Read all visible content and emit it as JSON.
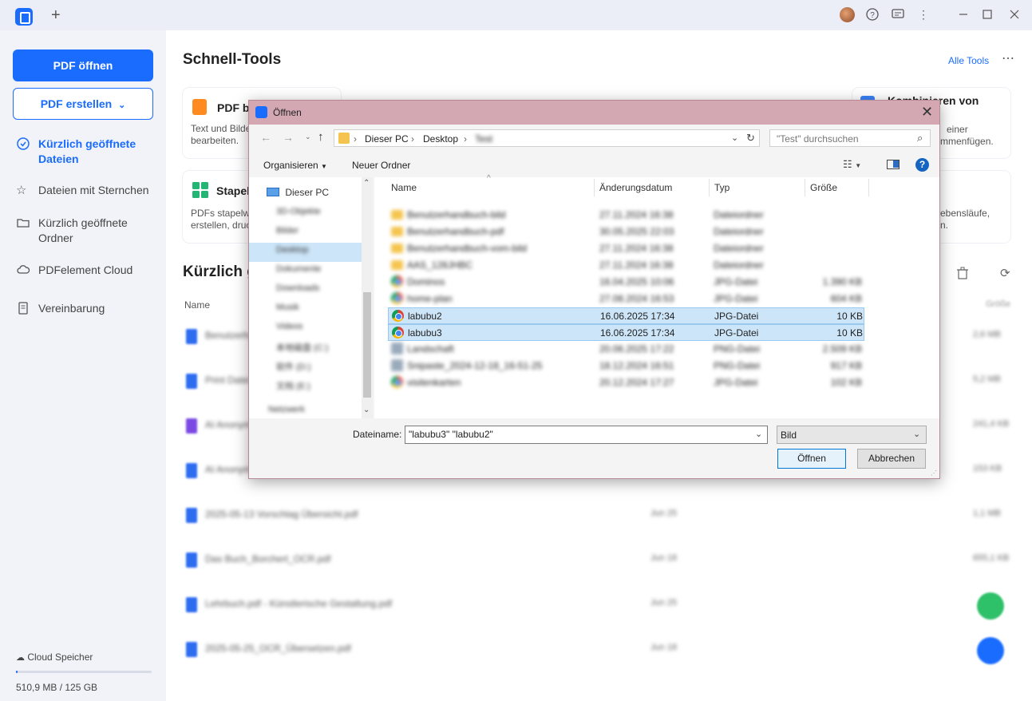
{
  "titlebar": {
    "new_tab": "+",
    "icons": [
      "avatar",
      "help-icon",
      "feedback-icon",
      "more-vertical-icon",
      "minimize-icon",
      "maximize-icon",
      "close-icon"
    ]
  },
  "sidebar": {
    "open_pdf": "PDF öffnen",
    "create_pdf": "PDF erstellen",
    "create_chevron": "⌄",
    "items": [
      {
        "label": "Kürzlich geöffnete Dateien",
        "icon": "clock-icon",
        "active": true
      },
      {
        "label": "Dateien mit Sternchen",
        "icon": "star-icon",
        "active": false
      },
      {
        "label": "Kürzlich geöffnete Ordner",
        "icon": "folder-icon",
        "active": false
      },
      {
        "label": "PDFelement Cloud",
        "icon": "cloud-icon",
        "active": false
      },
      {
        "label": "Vereinbarung",
        "icon": "document-icon",
        "active": false
      }
    ],
    "cloud_label": "Cloud Speicher",
    "storage_text": "510,9 MB / 125 GB",
    "storage_used_fraction": 0.004
  },
  "main": {
    "title": "Schnell-Tools",
    "all_tools": "Alle Tools",
    "more": "⋯",
    "cards": [
      {
        "title": "PDF be",
        "desc1": "Text und Bilde",
        "desc2": "bearbeiten."
      },
      {
        "title": "Kombinieren von",
        "desc1": "einer",
        "desc2": "mmenfügen."
      },
      {
        "title": "Stapel",
        "desc1": "PDFs stapelwe",
        "desc2": "erstellen, druc"
      },
      {
        "title": "",
        "desc1": "ebensläufe,",
        "desc2": "n."
      }
    ],
    "recent_title": "Kürzlich g",
    "col_name": "Name",
    "col_size": "Größe",
    "files": [
      {
        "name": "Benutzerhandbuch.pdf",
        "date": "",
        "size": "2,6 MB"
      },
      {
        "name": "Print Datei.pdf",
        "date": "",
        "size": "5,2 MB"
      },
      {
        "name": "AI Anonymisierung.pdf",
        "date": "",
        "size": "241,4 KB"
      },
      {
        "name": "AI Anonymisierung 2.pdf",
        "date": "",
        "size": "153 KB"
      },
      {
        "name": "2025-05-13 Vorschlag Übersicht.pdf",
        "date": "Jun 25",
        "size": "1,1 MB"
      },
      {
        "name": "Das Buch_Borchert_OCR.pdf",
        "date": "Jun 18",
        "size": "655,1 KB"
      },
      {
        "name": "Lehrbuch.pdf - Künstlerische Gestaltung.pdf",
        "date": "Jun 25",
        "size": ""
      },
      {
        "name": "2025-05-25_OCR_Übersetzen.pdf",
        "date": "Jun 18",
        "size": ""
      }
    ]
  },
  "dialog": {
    "title": "Öffnen",
    "breadcrumb": [
      "Dieser PC",
      "Desktop",
      "Test"
    ],
    "search_placeholder": "\"Test\" durchsuchen",
    "organize": "Organisieren",
    "new_folder": "Neuer Ordner",
    "nav": {
      "root": "Dieser PC",
      "items": [
        "3D-Objekte",
        "Bilder",
        "Desktop",
        "Dokumente",
        "Downloads",
        "Musik",
        "Videos",
        "本地磁盘 (C:)",
        "软件 (D:)",
        "文档 (E:)"
      ],
      "network": "Netzwerk"
    },
    "columns": {
      "name": "Name",
      "date": "Änderungsdatum",
      "type": "Typ",
      "size": "Größe"
    },
    "rows": [
      {
        "name": "Benutzerhandbuch-bild",
        "date": "27.11.2024 16:38",
        "type": "Dateiordner",
        "size": "",
        "icon": "folder",
        "selected": false,
        "blurred": true
      },
      {
        "name": "Benutzerhandbuch-pdf",
        "date": "30.05.2025 22:03",
        "type": "Dateiordner",
        "size": "",
        "icon": "folder",
        "selected": false,
        "blurred": true
      },
      {
        "name": "Benutzerhandbuch-vom-bild",
        "date": "27.11.2024 16:38",
        "type": "Dateiordner",
        "size": "",
        "icon": "folder",
        "selected": false,
        "blurred": true
      },
      {
        "name": "AAS_128JHBC",
        "date": "27.11.2024 16:38",
        "type": "Dateiordner",
        "size": "",
        "icon": "folder",
        "selected": false,
        "blurred": true
      },
      {
        "name": "Dominos",
        "date": "16.04.2025 10:06",
        "type": "JPG-Datei",
        "size": "1.390 KB",
        "icon": "chrome",
        "selected": false,
        "blurred": true
      },
      {
        "name": "home-plan",
        "date": "27.08.2024 16:53",
        "type": "JPG-Datei",
        "size": "604 KB",
        "icon": "chrome",
        "selected": false,
        "blurred": true
      },
      {
        "name": "labubu2",
        "date": "16.06.2025 17:34",
        "type": "JPG-Datei",
        "size": "10 KB",
        "icon": "chrome",
        "selected": true,
        "blurred": false
      },
      {
        "name": "labubu3",
        "date": "16.06.2025 17:34",
        "type": "JPG-Datei",
        "size": "10 KB",
        "icon": "chrome",
        "selected": true,
        "blurred": false
      },
      {
        "name": "Landschaft",
        "date": "20.06.2025 17:22",
        "type": "PNG-Datei",
        "size": "2.509 KB",
        "icon": "png",
        "selected": false,
        "blurred": true
      },
      {
        "name": "Snipaste_2024-12-18_16-51-25",
        "date": "18.12.2024 16:51",
        "type": "PNG-Datei",
        "size": "917 KB",
        "icon": "png",
        "selected": false,
        "blurred": true
      },
      {
        "name": "visitenkarten",
        "date": "20.12.2024 17:27",
        "type": "JPG-Datei",
        "size": "102 KB",
        "icon": "chrome",
        "selected": false,
        "blurred": true
      }
    ],
    "filename_label": "Dateiname:",
    "filename_value": "\"labubu3\" \"labubu2\"",
    "filetype_value": "Bild",
    "open_button": "Öffnen",
    "cancel_button": "Abbrechen"
  }
}
